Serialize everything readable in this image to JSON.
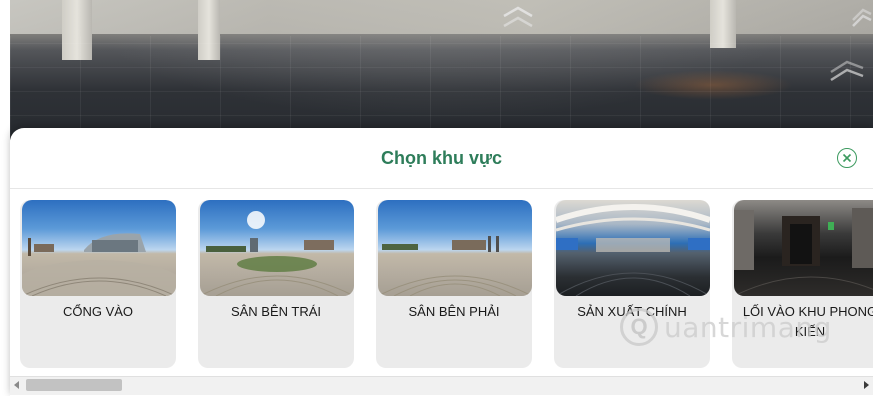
{
  "panel": {
    "title": "Chọn khu vực",
    "close_icon": "close-circle-icon"
  },
  "locations": [
    {
      "label": "CỔNG VÀO",
      "scene": "outdoor-gate"
    },
    {
      "label": "SÂN BÊN TRÁI",
      "scene": "outdoor-courtyard"
    },
    {
      "label": "SÂN BÊN PHẢI",
      "scene": "outdoor-courtyard"
    },
    {
      "label": "SẢN XUẤT CHÍNH",
      "scene": "indoor-hall"
    },
    {
      "label": "LỐI VÀO KHU PHONG KIẾN",
      "scene": "indoor-dark"
    }
  ],
  "navigation": {
    "forward_icon": "double-chevron-up-icon"
  },
  "scrollbar": {
    "position": 0.0
  },
  "watermark": {
    "text": "uantrimang",
    "letter": "Q"
  },
  "colors": {
    "accent": "#2e7d5a",
    "card_bg": "#ebebeb"
  }
}
